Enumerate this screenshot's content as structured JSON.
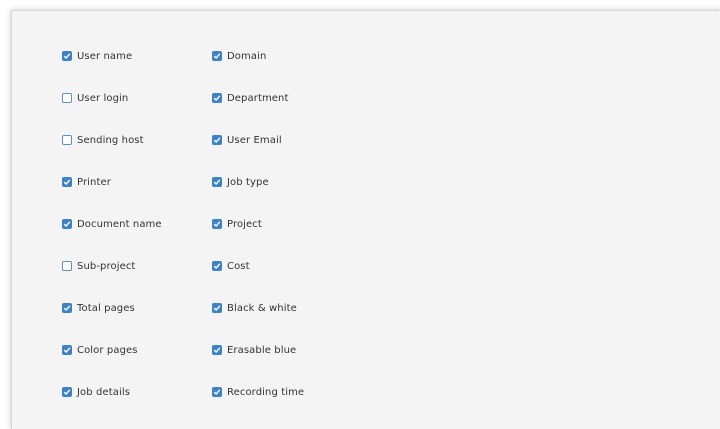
{
  "left_column": [
    {
      "label": "User name",
      "checked": true
    },
    {
      "label": "User login",
      "checked": false
    },
    {
      "label": "Sending host",
      "checked": false
    },
    {
      "label": "Printer",
      "checked": true
    },
    {
      "label": "Document name",
      "checked": true
    },
    {
      "label": "Sub-project",
      "checked": false
    },
    {
      "label": "Total pages",
      "checked": true
    },
    {
      "label": "Color pages",
      "checked": true
    },
    {
      "label": "Job details",
      "checked": true
    }
  ],
  "right_column": [
    {
      "label": "Domain",
      "checked": true
    },
    {
      "label": "Department",
      "checked": true
    },
    {
      "label": "User Email",
      "checked": true
    },
    {
      "label": "Job type",
      "checked": true
    },
    {
      "label": "Project",
      "checked": true
    },
    {
      "label": "Cost",
      "checked": true
    },
    {
      "label": "Black & white",
      "checked": true
    },
    {
      "label": "Erasable blue",
      "checked": true
    },
    {
      "label": "Recording time",
      "checked": true
    }
  ],
  "colors": {
    "accent": "#3d82c4",
    "panel_background": "#f4f4f4",
    "text": "#333333"
  }
}
